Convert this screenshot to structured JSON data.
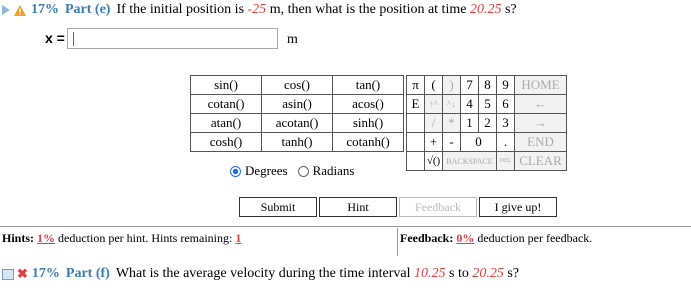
{
  "part_e": {
    "percent": "17%",
    "label": "Part (e)",
    "q_before": "If the initial position is",
    "initial_pos": "-25",
    "q_mid": "m, then what is the position at time",
    "time": "20.25",
    "q_after": "s?"
  },
  "answer": {
    "label": "x =",
    "value": "",
    "unit": "m"
  },
  "calculator": {
    "functions": [
      [
        "sin()",
        "cos()",
        "tan()"
      ],
      [
        "cotan()",
        "asin()",
        "acos()"
      ],
      [
        "atan()",
        "acotan()",
        "sinh()"
      ],
      [
        "cosh()",
        "tanh()",
        "cotanh()"
      ]
    ],
    "row1_keys": [
      "π",
      "(",
      ")",
      "7",
      "8",
      "9"
    ],
    "row2_keys": [
      "E",
      "↑^",
      "^↓",
      "4",
      "5",
      "6"
    ],
    "row3_keys": [
      "",
      "/",
      "*",
      "1",
      "2",
      "3"
    ],
    "row4_keys": [
      "",
      "+",
      "-",
      "0",
      "."
    ],
    "row5_keys": [
      "√()",
      "BACKSPACE",
      "DEL",
      "CLEAR"
    ],
    "side": [
      "HOME",
      "←",
      "→",
      "END"
    ],
    "degrees": "Degrees",
    "radians": "Radians",
    "mode": "Degrees"
  },
  "buttons": {
    "submit": "Submit",
    "hint": "Hint",
    "feedback": "Feedback",
    "give_up": "I give up!"
  },
  "hints": {
    "prefix": "Hints:",
    "pct": "1%",
    "text": "deduction per hint. Hints remaining:",
    "remaining": "1"
  },
  "feedback": {
    "prefix": "Feedback:",
    "pct": "0%",
    "text": "deduction per feedback."
  },
  "part_f": {
    "percent": "17%",
    "label": "Part (f)",
    "q_before": "What is the average velocity during the time interval",
    "t1": "10.25",
    "q_mid": "s to",
    "t2": "20.25",
    "q_after": "s?"
  },
  "colors": {
    "accent": "#3b7db0",
    "red": "#e04040"
  }
}
